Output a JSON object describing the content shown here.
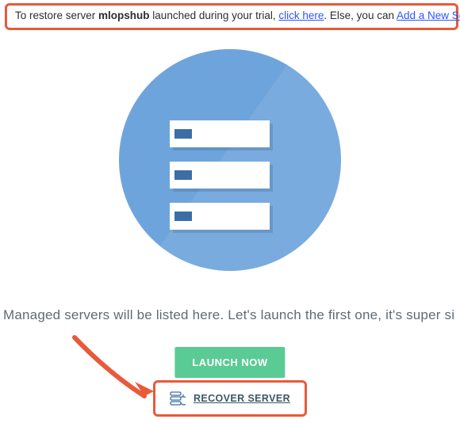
{
  "notice": {
    "prefix": "To restore server ",
    "server_name": "mlopshub",
    "mid1": " launched during your trial, ",
    "link1": "click here",
    "mid2": ". Else, you can ",
    "link2": "Add a New Server"
  },
  "description": "Managed servers will be listed here. Let's launch the first one, it's super si",
  "buttons": {
    "launch": "LAUNCH NOW",
    "recover": "RECOVER SERVER"
  }
}
